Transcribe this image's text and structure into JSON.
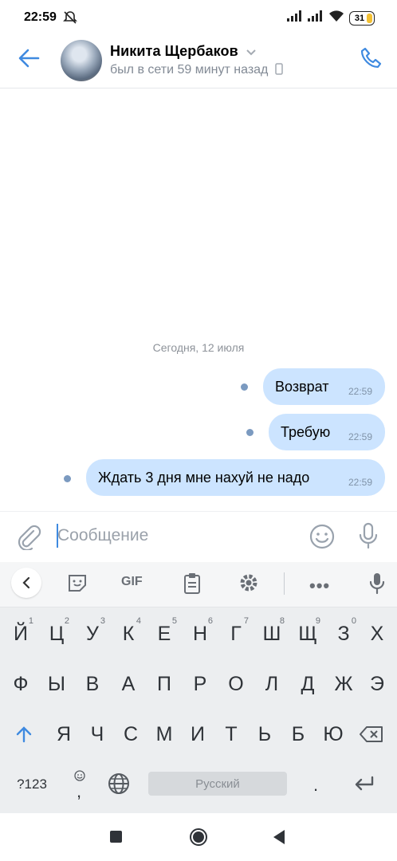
{
  "status_bar": {
    "time": "22:59",
    "battery": "31"
  },
  "header": {
    "contact_name": "Никита Щербаков",
    "status": "был в сети 59 минут назад"
  },
  "chat": {
    "date_separator": "Сегодня, 12 июля",
    "messages": [
      {
        "text": "Возврат",
        "time": "22:59",
        "outgoing": true
      },
      {
        "text": "Требую",
        "time": "22:59",
        "outgoing": true
      },
      {
        "text": "Ждать 3 дня мне нахуй не надо",
        "time": "22:59",
        "outgoing": true
      }
    ]
  },
  "composer": {
    "placeholder": "Сообщение"
  },
  "keyboard": {
    "toolbar_gif": "GIF",
    "row1": [
      "Й",
      "Ц",
      "У",
      "К",
      "Е",
      "Н",
      "Г",
      "Ш",
      "Щ",
      "З",
      "Х"
    ],
    "row1_hints": [
      "1",
      "2",
      "3",
      "4",
      "5",
      "6",
      "7",
      "8",
      "9",
      "0"
    ],
    "row2": [
      "Ф",
      "Ы",
      "В",
      "А",
      "П",
      "Р",
      "О",
      "Л",
      "Д",
      "Ж",
      "Э"
    ],
    "row3": [
      "Я",
      "Ч",
      "С",
      "М",
      "И",
      "Т",
      "Ь",
      "Б",
      "Ю"
    ],
    "symbols_key": "?123",
    "punct_key": ",",
    "period_key": ".",
    "space_label": "Русский"
  },
  "colors": {
    "accent": "#3f8ae0",
    "outgoing_bubble": "#cce4ff",
    "unread_dot": "#7b9ac0"
  }
}
